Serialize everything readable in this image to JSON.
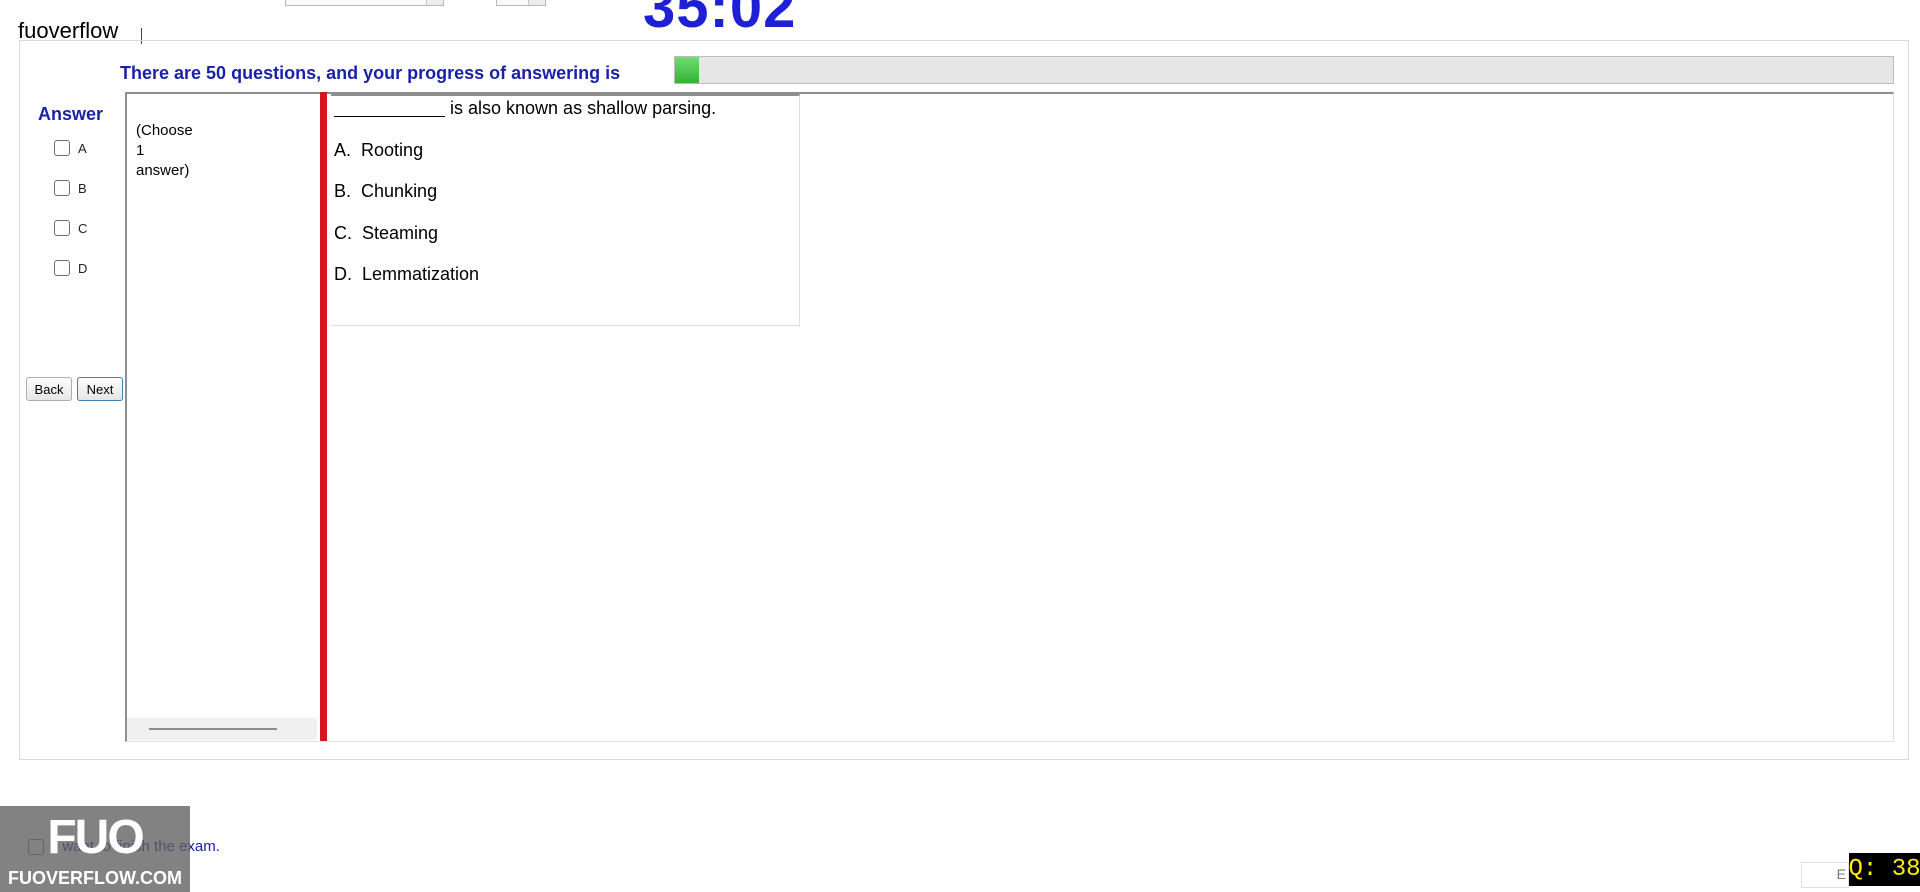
{
  "header": {
    "brand": "fuoverflow",
    "timer": "35:02"
  },
  "progress": {
    "label": "There are 50 questions, and your progress of answering is",
    "fraction": 0.02
  },
  "answer_panel": {
    "title": "Answer",
    "options": [
      "A",
      "B",
      "C",
      "D"
    ],
    "checked": [
      false,
      false,
      false,
      false
    ]
  },
  "nav": {
    "back_label": "Back",
    "next_label": "Next"
  },
  "instruction": "(Choose\n1\nanswer)",
  "question": {
    "text": "is also known as shallow parsing.",
    "choices": [
      {
        "letter": "A.",
        "text": "Rooting"
      },
      {
        "letter": "B.",
        "text": "Chunking"
      },
      {
        "letter": "C.",
        "text": "Steaming"
      },
      {
        "letter": "D.",
        "text": "Lemmatization"
      }
    ]
  },
  "finish": {
    "label": "I want to finish the exam.",
    "checked": false
  },
  "watermark": {
    "logo": "FUO",
    "url": "FUOVERFLOW.COM"
  },
  "footer": {
    "question_badge": "Q: 38",
    "small_field_text": "E"
  },
  "colors": {
    "accent_blue": "#1a22a8",
    "timer_blue": "#1f1fd6",
    "progress_green": "#34b234",
    "separator_red": "#d5161d"
  }
}
